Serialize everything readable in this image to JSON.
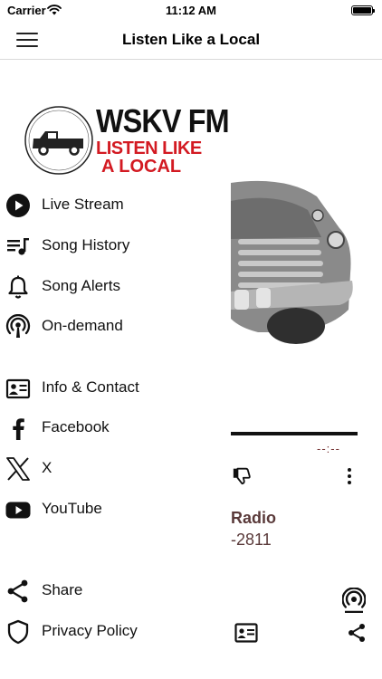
{
  "status": {
    "carrier": "Carrier",
    "time": "11:12 AM",
    "battery_level": 1.0
  },
  "navbar": {
    "title": "Listen Like a Local",
    "menu_icon": "hamburger-menu-icon"
  },
  "logo": {
    "call_sign": "WSKV FM",
    "tagline_line1": "LISTEN LIKE",
    "tagline_line2": "A LOCAL",
    "seal_text_top": "Pickup Country",
    "seal_freq": "104.9 FM",
    "seal_text_bottom": "LISTEN LIKE A LOCAL"
  },
  "drawer": {
    "primary_items": [
      {
        "label": "Live Stream",
        "icon": "play-circle-icon"
      },
      {
        "label": "Song History",
        "icon": "playlist-icon"
      },
      {
        "label": "Song Alerts",
        "icon": "bell-icon"
      },
      {
        "label": "On-demand",
        "icon": "podcast-icon"
      }
    ],
    "social_items": [
      {
        "label": "Info & Contact",
        "icon": "contact-card-icon"
      },
      {
        "label": "Facebook",
        "icon": "facebook-icon"
      },
      {
        "label": "X",
        "icon": "x-logo-icon"
      },
      {
        "label": "YouTube",
        "icon": "youtube-icon"
      }
    ],
    "footer_items": [
      {
        "label": "Share",
        "icon": "share-icon"
      },
      {
        "label": "Privacy Policy",
        "icon": "shield-icon"
      }
    ]
  },
  "player": {
    "elapsed": "--:--",
    "station_name_fragment": "Radio",
    "phone_fragment": "-2811",
    "progress": 1.0
  },
  "colors": {
    "brand_red": "#d31a22",
    "text": "#111111",
    "station_text": "#5a3a3a"
  }
}
